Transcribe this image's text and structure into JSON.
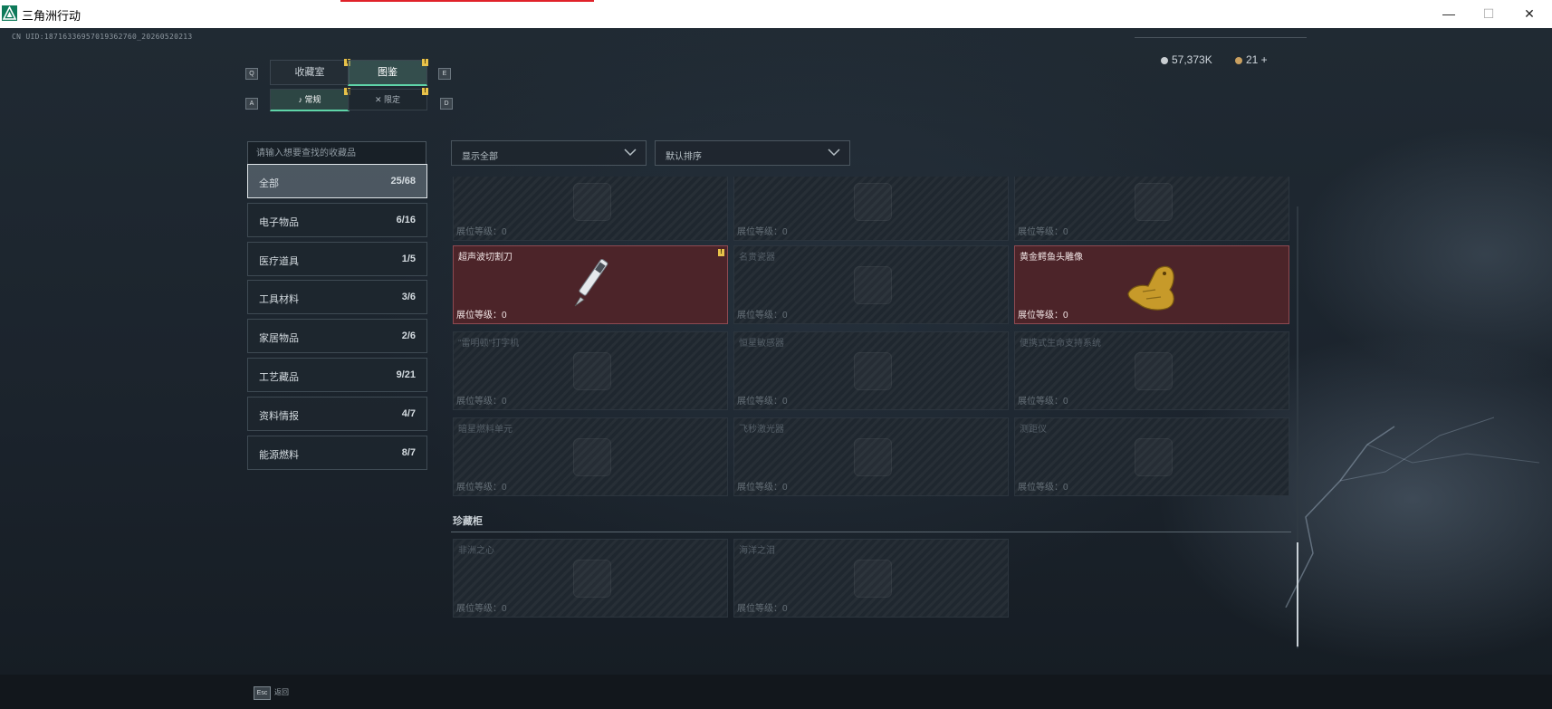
{
  "window": {
    "title": "三角洲行动",
    "minimize": "—",
    "maximize": "☐",
    "close": "✕"
  },
  "uid": "CN UID:18716336957019362760_20260520213",
  "currency": [
    {
      "value": "57,373K"
    },
    {
      "value": "21 +"
    }
  ],
  "tabs": {
    "left_key": "Q",
    "right_key": "E",
    "items": [
      {
        "label": "收藏室",
        "active": false
      },
      {
        "label": "图鉴",
        "active": true
      }
    ]
  },
  "subtabs": {
    "left_key": "A",
    "right_key": "D",
    "items": [
      {
        "label": "常规",
        "active": true
      },
      {
        "label": "限定",
        "active": false
      }
    ]
  },
  "search": {
    "placeholder": "请输入想要查找的收藏品"
  },
  "categories": [
    {
      "label": "全部",
      "count": "25/68"
    },
    {
      "label": "电子物品",
      "count": "6/16"
    },
    {
      "label": "医疗道具",
      "count": "1/5"
    },
    {
      "label": "工具材料",
      "count": "3/6"
    },
    {
      "label": "家居物品",
      "count": "2/6"
    },
    {
      "label": "工艺藏品",
      "count": "9/21"
    },
    {
      "label": "资料情报",
      "count": "4/7"
    },
    {
      "label": "能源燃料",
      "count": "8/7"
    }
  ],
  "filters": {
    "display": "显示全部",
    "sort": "默认排序"
  },
  "items": [
    {
      "name": "",
      "level": "展位等级：0",
      "owned": false
    },
    {
      "name": "",
      "level": "展位等级：0",
      "owned": false
    },
    {
      "name": "",
      "level": "展位等级：0",
      "owned": false
    },
    {
      "name": "超声波切割刀",
      "level": "展位等级：0",
      "owned": true,
      "icon": "ultrasonic-knife-icon",
      "badge": "!"
    },
    {
      "name": "名贵瓷器",
      "level": "展位等级：0",
      "owned": false
    },
    {
      "name": "黄金鳄鱼头雕像",
      "level": "展位等级：0",
      "owned": true,
      "icon": "golden-crocodile-statue-icon"
    },
    {
      "name": "\"雷明顿\"打字机",
      "level": "展位等级：0",
      "owned": false
    },
    {
      "name": "恒星敏感器",
      "level": "展位等级：0",
      "owned": false
    },
    {
      "name": "便携式生命支持系统",
      "level": "展位等级：0",
      "owned": false
    },
    {
      "name": "暗星燃料单元",
      "level": "展位等级：0",
      "owned": false
    },
    {
      "name": "飞秒激光器",
      "level": "展位等级：0",
      "owned": false
    },
    {
      "name": "测距仪",
      "level": "展位等级：0",
      "owned": false
    }
  ],
  "cabinet": {
    "title": "珍藏柜",
    "items": [
      {
        "name": "非洲之心",
        "level": "展位等级：0"
      },
      {
        "name": "海洋之泪",
        "level": "展位等级：0"
      }
    ]
  },
  "footer": {
    "key": "Esc",
    "label": "返回"
  },
  "badge_text": "!",
  "colors": {
    "accent": "#5fd4a8",
    "owned_bg": "#4c2429",
    "badge": "#e8c24a"
  }
}
